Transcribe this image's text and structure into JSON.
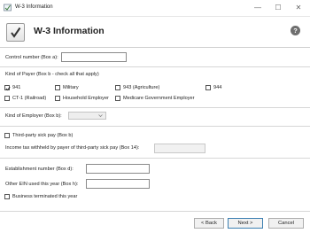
{
  "window": {
    "title": "W-3 Information",
    "minimize_glyph": "—",
    "maximize_glyph": "☐",
    "close_glyph": "✕"
  },
  "header": {
    "title": "W-3 Information",
    "help_glyph": "?"
  },
  "control_number": {
    "label": "Control number (Box a):",
    "value": ""
  },
  "payer_kind": {
    "label": "Kind of Payer (Box b - check all that apply)",
    "options": [
      {
        "label": "941",
        "checked": true
      },
      {
        "label": "Military",
        "checked": false
      },
      {
        "label": "943 (Agriculture)",
        "checked": false
      },
      {
        "label": "944",
        "checked": false
      },
      {
        "label": "CT-1 (Railroad)",
        "checked": false
      },
      {
        "label": "Household Employer",
        "checked": false
      },
      {
        "label": "Medicare Government Employer",
        "checked": false
      }
    ]
  },
  "employer_kind": {
    "label": "Kind of Employer (Box b):",
    "value": ""
  },
  "third_party": {
    "checkbox_label": "Third-party sick pay (Box b)",
    "tax_label": "Income tax withheld by payer of third-party sick pay (Box 14):",
    "tax_value": ""
  },
  "establishment": {
    "label": "Establishment number (Box d):",
    "value": ""
  },
  "other_ein": {
    "label": "Other EIN used this year (Box h):",
    "value": ""
  },
  "terminated": {
    "label": "Business terminated this year"
  },
  "footer": {
    "back_label": "< Back",
    "next_label": "Next >",
    "cancel_label": "Cancel"
  },
  "colors": {
    "check": "#222222",
    "primary_border": "#3c7fb1"
  }
}
